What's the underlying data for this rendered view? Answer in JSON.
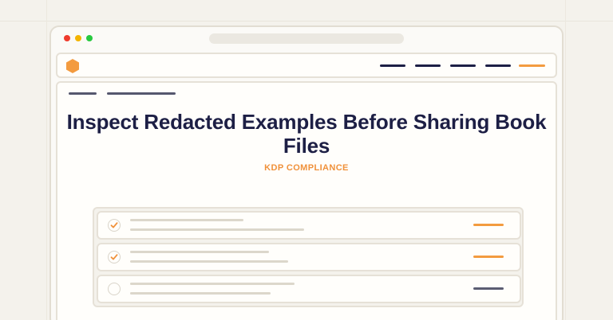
{
  "page": {
    "title": "Inspect Redacted Examples Before Sharing Book Files",
    "category": "KDP COMPLIANCE"
  },
  "nav": {
    "logo_icon": "hexagon-logo-icon",
    "links": 4,
    "cta_color": "#f39b3f"
  },
  "checklist": {
    "items": [
      {
        "checked": true,
        "status": "done"
      },
      {
        "checked": true,
        "status": "done"
      },
      {
        "checked": false,
        "status": "pending"
      }
    ]
  },
  "colors": {
    "accent": "#f39b3f",
    "heading": "#1d1f45",
    "background": "#f4f2ec"
  }
}
